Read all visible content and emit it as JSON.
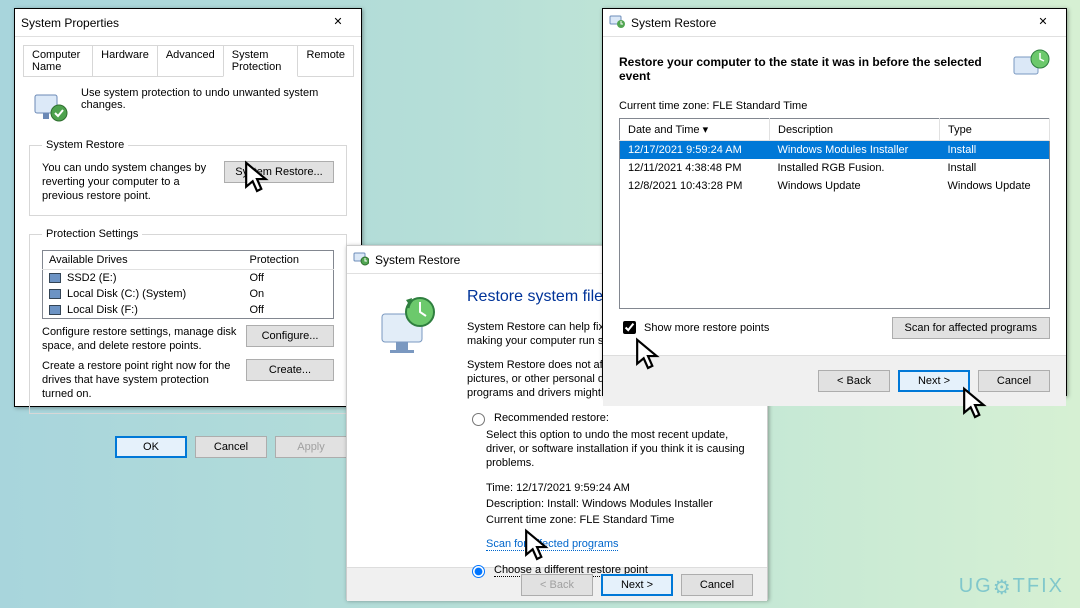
{
  "w1": {
    "title": "System Properties",
    "tabs": [
      "Computer Name",
      "Hardware",
      "Advanced",
      "System Protection",
      "Remote"
    ],
    "active_tab": 3,
    "hint": "Use system protection to undo unwanted system changes.",
    "group_restore": {
      "legend": "System Restore",
      "text": "You can undo system changes by reverting your computer to a previous restore point.",
      "button": "System Restore..."
    },
    "group_protection": {
      "legend": "Protection Settings",
      "col_drive": "Available Drives",
      "col_prot": "Protection",
      "rows": [
        {
          "name": "SSD2 (E:)",
          "prot": "Off"
        },
        {
          "name": "Local Disk (C:) (System)",
          "prot": "On"
        },
        {
          "name": "Local Disk (F:)",
          "prot": "Off"
        }
      ],
      "cfg_text": "Configure restore settings, manage disk space, and delete restore points.",
      "cfg_btn": "Configure...",
      "create_text": "Create a restore point right now for the drives that have system protection turned on.",
      "create_btn": "Create..."
    },
    "buttons": {
      "ok": "OK",
      "cancel": "Cancel",
      "apply": "Apply"
    }
  },
  "w2": {
    "title": "System Restore",
    "h": "Restore system files and settings",
    "p1": "System Restore can help fix problems that might be making your computer run slowly or stop responding.",
    "p2": "System Restore does not affect any of your documents, pictures, or other personal data. Recently installed programs and drivers might be uninstalled.",
    "opt_recommended": "Recommended restore:",
    "opt_rec_sub": "Select this option to undo the most recent update, driver, or software installation if you think it is causing problems.",
    "time_lbl": "Time:",
    "time_val": "12/17/2021 9:59:24 AM",
    "desc_lbl": "Description:",
    "desc_val": "Install: Windows Modules Installer",
    "tz_lbl": "Current time zone:",
    "tz_val": "FLE Standard Time",
    "scan_link": "Scan for affected programs",
    "opt_different": "Choose a different restore point",
    "buttons": {
      "back": "< Back",
      "next": "Next >",
      "cancel": "Cancel"
    }
  },
  "w3": {
    "title": "System Restore",
    "headline": "Restore your computer to the state it was in before the selected event",
    "tz": "Current time zone: FLE Standard Time",
    "cols": [
      "Date and Time",
      "Description",
      "Type"
    ],
    "rows": [
      {
        "dt": "12/17/2021 9:59:24 AM",
        "desc": "Windows Modules Installer",
        "type": "Install",
        "selected": true
      },
      {
        "dt": "12/11/2021 4:38:48 PM",
        "desc": "Installed RGB Fusion.",
        "type": "Install"
      },
      {
        "dt": "12/8/2021 10:43:28 PM",
        "desc": "Windows Update",
        "type": "Windows Update"
      }
    ],
    "show_more": "Show more restore points",
    "scan_btn": "Scan for affected programs",
    "buttons": {
      "back": "< Back",
      "next": "Next >",
      "cancel": "Cancel"
    }
  },
  "logo": "UG  TFIX"
}
